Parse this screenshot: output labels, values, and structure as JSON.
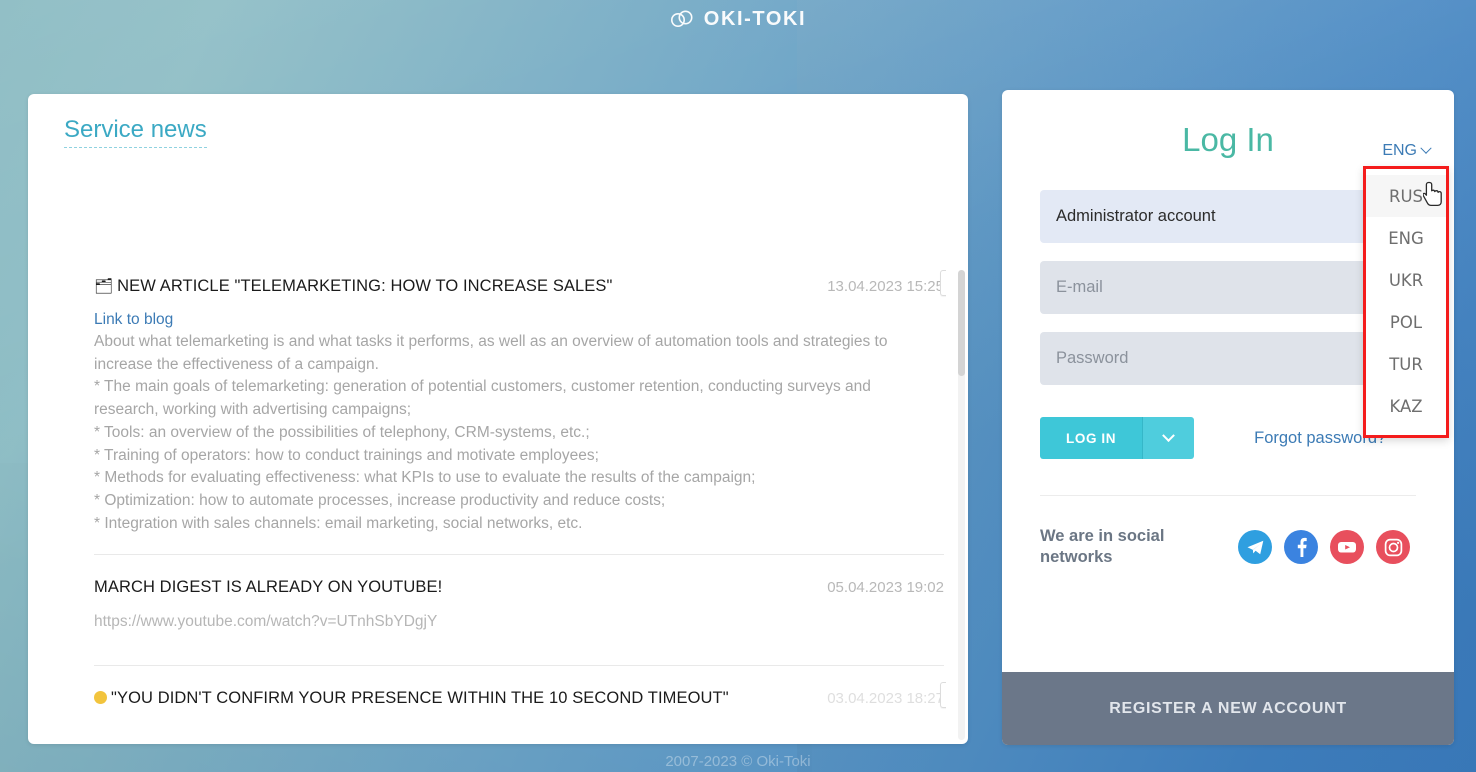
{
  "brand": {
    "name": "OKI-TOKI",
    "logo_icon": "cloud-icon"
  },
  "news_panel": {
    "title": "Service news",
    "items": [
      {
        "emoji": "🗂",
        "title": "NEW ARTICLE \"TELEMARKETING: HOW TO INCREASE SALES\"",
        "date": "13.04.2023 15:25",
        "link_label": "Link to blog",
        "body": "About what telemarketing is and what tasks it performs, as well as an overview of automation tools and strategies to increase the effectiveness of a campaign.\n* The main goals of telemarketing: generation of potential customers, customer retention, conducting surveys and research, working with advertising campaigns;\n* Tools: an overview of the possibilities of telephony, CRM-systems, etc.;\n* Training of operators: how to conduct trainings and motivate employees;\n* Methods for evaluating effectiveness: what KPIs to use to evaluate the results of the campaign;\n* Optimization: how to automate processes, increase productivity and reduce costs;\n* Integration with sales channels: email marketing, social networks, etc.",
        "has_image_button": true
      },
      {
        "emoji": "",
        "title": "MARCH DIGEST IS ALREADY ON YOUTUBE!",
        "date": "05.04.2023 19:02",
        "link_label": "",
        "body": "https://www.youtube.com/watch?v=UTnhSbYDgjY",
        "has_image_button": false
      },
      {
        "emoji": "●",
        "title": "\"YOU DIDN'T CONFIRM YOUR PRESENCE WITHIN THE 10 SECOND TIMEOUT\"",
        "date": "03.04.2023 18:27",
        "link_label": "",
        "body": "",
        "has_image_button": true
      }
    ]
  },
  "login": {
    "title": "Log In",
    "language": {
      "current": "ENG",
      "chevron_icon": "chevron-down-icon",
      "options": [
        "RUS",
        "ENG",
        "UKR",
        "POL",
        "TUR",
        "KAZ"
      ],
      "hovered": "RUS",
      "highlight_color": "#f41c1c"
    },
    "fields": {
      "account_value": "Administrator account",
      "email_placeholder": "E-mail",
      "password_placeholder": "Password"
    },
    "login_button": "LOG IN",
    "login_button_caret_icon": "chevron-down-icon",
    "forgot_password": "Forgot password?",
    "social": {
      "label": "We are in social networks",
      "networks": [
        {
          "name": "telegram-icon",
          "color": "#2f9fe0"
        },
        {
          "name": "facebook-icon",
          "color": "#3b83e0"
        },
        {
          "name": "youtube-icon",
          "color": "#e84f5d"
        },
        {
          "name": "instagram-icon",
          "color": "#e84f5d"
        }
      ]
    },
    "register_button": "REGISTER A NEW ACCOUNT"
  },
  "footer": {
    "copyright": "2007-2023 © Oki-Toki"
  },
  "theme": {
    "accent_teal": "#3ec7d8",
    "title_green": "#4ab8a4",
    "link_blue": "#3c7bb5",
    "news_title_blue": "#3ba9c4",
    "register_gray": "#6b7789"
  }
}
